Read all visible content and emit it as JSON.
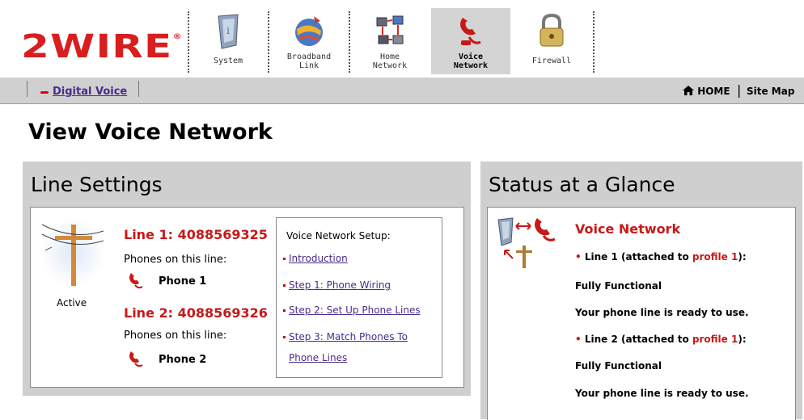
{
  "brand": {
    "logo_text": "2WIRE",
    "logo_mark": "®"
  },
  "tabs": [
    {
      "label_l1": "System",
      "label_l2": "",
      "icon": "system-icon",
      "active": false
    },
    {
      "label_l1": "Broadband",
      "label_l2": "Link",
      "icon": "globe-icon",
      "active": false
    },
    {
      "label_l1": "Home",
      "label_l2": "Network",
      "icon": "network-icon",
      "active": false
    },
    {
      "label_l1": "Voice",
      "label_l2": "Network",
      "icon": "phone-icon",
      "active": true
    },
    {
      "label_l1": "Firewall",
      "label_l2": "",
      "icon": "padlock-icon",
      "active": false
    }
  ],
  "subnav": {
    "item": "Digital Voice",
    "home": "HOME",
    "separator": "|",
    "sitemap": "Site Map"
  },
  "page_title": "View Voice Network",
  "line_settings": {
    "title": "Line Settings",
    "status": "Active",
    "lines": [
      {
        "title": "Line 1: 4088569325",
        "phones_label": "Phones on this line:",
        "phone": "Phone 1"
      },
      {
        "title": "Line 2: 4088569326",
        "phones_label": "Phones on this line:",
        "phone": "Phone 2"
      }
    ],
    "setup": {
      "title": "Voice Network Setup:",
      "links": [
        "Introduction",
        "Step 1: Phone Wiring",
        "Step 2: Set Up Phone Lines",
        "Step 3: Match Phones To",
        "Phone Lines"
      ]
    }
  },
  "status": {
    "title": "Status at a Glance",
    "heading": "Voice Network",
    "bullet": "•",
    "line1": {
      "pre": "Line 1 (attached to ",
      "profile": "profile 1",
      "post": "):",
      "state": "Fully Functional",
      "msg": "Your phone line is ready to use."
    },
    "line2": {
      "pre": "Line 2 (attached to ",
      "profile": "profile 1",
      "post": "):",
      "state": "Fully Functional",
      "msg": "Your phone line is ready to use."
    }
  },
  "colors": {
    "accent_red": "#c81818",
    "link": "#4a2c8c",
    "panel_gray": "#cfcfcf"
  }
}
